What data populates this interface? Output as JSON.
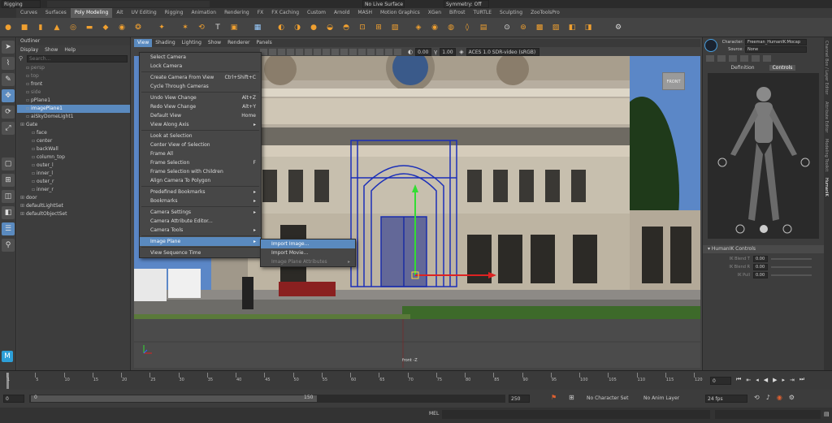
{
  "topbar": {
    "mode": "Rigging",
    "live_surface": "No Live Surface",
    "symmetry": "Symmetry: Off"
  },
  "shelf_tabs": [
    "Curves",
    "Surfaces",
    "Poly Modeling",
    "Ait",
    "UV Editing",
    "Rigging",
    "Animation",
    "Rendering",
    "FX",
    "FX Caching",
    "Custom",
    "Arnold",
    "MASH",
    "Motion Graphics",
    "XGen",
    "Bifrost",
    "TURTLE",
    "Sculpting",
    "ZooToolsPro"
  ],
  "shelf_active": "Poly Modeling",
  "outliner": {
    "title": "Outliner",
    "menu": [
      "Display",
      "Show",
      "Help"
    ],
    "search_placeholder": "Search...",
    "items": [
      {
        "label": "persp",
        "dim": true,
        "indent": 1
      },
      {
        "label": "top",
        "dim": true,
        "indent": 1
      },
      {
        "label": "front",
        "dim": false,
        "indent": 1
      },
      {
        "label": "side",
        "dim": true,
        "indent": 1
      },
      {
        "label": "pPlane1",
        "dim": false,
        "indent": 1
      },
      {
        "label": "imagePlane1",
        "dim": false,
        "indent": 1,
        "selected": true
      },
      {
        "label": "aiSkyDomeLight1",
        "dim": false,
        "indent": 1
      },
      {
        "label": "Gate",
        "dim": false,
        "indent": 0
      },
      {
        "label": "face",
        "dim": false,
        "indent": 2
      },
      {
        "label": "center",
        "dim": false,
        "indent": 2
      },
      {
        "label": "backWall",
        "dim": false,
        "indent": 2
      },
      {
        "label": "column_top",
        "dim": false,
        "indent": 2
      },
      {
        "label": "outer_l",
        "dim": false,
        "indent": 2
      },
      {
        "label": "inner_l",
        "dim": false,
        "indent": 2
      },
      {
        "label": "outer_r",
        "dim": false,
        "indent": 2
      },
      {
        "label": "inner_r",
        "dim": false,
        "indent": 2
      },
      {
        "label": "door",
        "dim": false,
        "indent": 0
      },
      {
        "label": "defaultLightSet",
        "dim": false,
        "indent": 0
      },
      {
        "label": "defaultObjectSet",
        "dim": false,
        "indent": 0
      }
    ]
  },
  "viewport": {
    "menu": [
      "View",
      "Shading",
      "Lighting",
      "Show",
      "Renderer",
      "Panels"
    ],
    "exposure": "0.00",
    "gamma": "1.00",
    "colorspace": "ACES 1.0 SDR-video (sRGB)",
    "camera_label": "front -Z",
    "cube_label": "FRONT"
  },
  "view_menu": [
    {
      "label": "Select Camera",
      "shortcut": ""
    },
    {
      "label": "Lock Camera",
      "shortcut": ""
    },
    {
      "sep": true
    },
    {
      "label": "Create Camera From View",
      "shortcut": "Ctrl+Shift+C"
    },
    {
      "label": "Cycle Through Cameras",
      "shortcut": ""
    },
    {
      "sep": true
    },
    {
      "label": "Undo View Change",
      "shortcut": "Alt+Z"
    },
    {
      "label": "Redo View Change",
      "shortcut": "Alt+Y"
    },
    {
      "label": "Default View",
      "shortcut": "Home"
    },
    {
      "label": "View Along Axis",
      "shortcut": "▸"
    },
    {
      "sep": true
    },
    {
      "label": "Look at Selection",
      "shortcut": ""
    },
    {
      "label": "Center View of Selection",
      "shortcut": ""
    },
    {
      "label": "Frame All",
      "shortcut": ""
    },
    {
      "label": "Frame Selection",
      "shortcut": "F"
    },
    {
      "label": "Frame Selection with Children",
      "shortcut": ""
    },
    {
      "label": "Align Camera To Polygon",
      "shortcut": ""
    },
    {
      "sep": true
    },
    {
      "label": "Predefined Bookmarks",
      "shortcut": "▸"
    },
    {
      "label": "Bookmarks",
      "shortcut": "▸"
    },
    {
      "sep": true
    },
    {
      "label": "Camera Settings",
      "shortcut": "▸"
    },
    {
      "label": "Camera Attribute Editor...",
      "shortcut": ""
    },
    {
      "label": "Camera Tools",
      "shortcut": "▸"
    },
    {
      "sep": true
    },
    {
      "label": "Image Plane",
      "shortcut": "▸",
      "highlight": true
    },
    {
      "sep": true
    },
    {
      "label": "View Sequence Time",
      "shortcut": ""
    }
  ],
  "image_plane_menu": [
    {
      "label": "Import Image...",
      "highlight": true
    },
    {
      "label": "Import Movie..."
    },
    {
      "label": "Image Plane Attributes",
      "disabled": true,
      "shortcut": "▸"
    }
  ],
  "right_panel": {
    "character_label": "Character:",
    "character_value": "Freeman_HumanIK:Mocap",
    "source_label": "Source:",
    "source_value": "None",
    "tabs": [
      "Definition",
      "Controls"
    ],
    "active_tab": "Controls",
    "section": "HumanIK Controls",
    "controls": [
      {
        "label": "IK Blend T",
        "value": "0.00"
      },
      {
        "label": "IK Blend R",
        "value": "0.00"
      },
      {
        "label": "IK Pull",
        "value": "0.00"
      }
    ],
    "side_tabs": [
      "Channel Box / Layer Editor",
      "Attribute Editor",
      "Modeling Toolkit",
      "HumanIK"
    ]
  },
  "timeline": {
    "ticks": [
      "1",
      "5",
      "10",
      "15",
      "20",
      "25",
      "30",
      "35",
      "40",
      "45",
      "50",
      "55",
      "60",
      "65",
      "70",
      "75",
      "80",
      "85",
      "90",
      "95",
      "100",
      "105",
      "110",
      "115",
      "120"
    ],
    "current_frame": "0",
    "range_start": "0",
    "range_inner_start": "0",
    "range_inner_end": "150",
    "range_end": "250",
    "anim_start": "1",
    "character_set": "No Character Set",
    "anim_layer": "No Anim Layer",
    "fps": "24 fps"
  },
  "cmdline": {
    "label": "MEL"
  },
  "colors": {
    "accent": "#5a8abf",
    "shelf_icon": "#f0a030",
    "sky": "#5b87c7"
  }
}
